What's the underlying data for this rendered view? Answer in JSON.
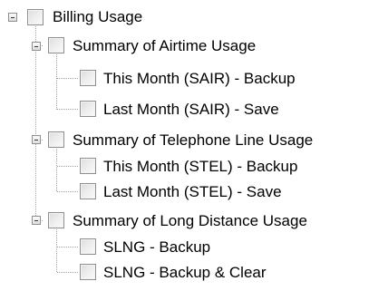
{
  "tree": {
    "root": {
      "label": "Billing Usage",
      "expanded": true,
      "checked": false,
      "groups": [
        {
          "label": "Summary of Airtime Usage",
          "expanded": true,
          "checked": false,
          "items": [
            {
              "label": "This Month (SAIR) - Backup",
              "checked": false
            },
            {
              "label": "Last Month (SAIR) - Save",
              "checked": false
            }
          ]
        },
        {
          "label": "Summary of Telephone Line Usage",
          "expanded": true,
          "checked": false,
          "items": [
            {
              "label": "This Month (STEL) - Backup",
              "checked": false
            },
            {
              "label": "Last Month (STEL) - Save",
              "checked": false
            }
          ]
        },
        {
          "label": "Summary of Long Distance Usage",
          "expanded": true,
          "checked": false,
          "items": [
            {
              "label": "SLNG - Backup",
              "checked": false
            },
            {
              "label": "SLNG - Backup & Clear",
              "checked": false
            }
          ]
        }
      ]
    }
  }
}
